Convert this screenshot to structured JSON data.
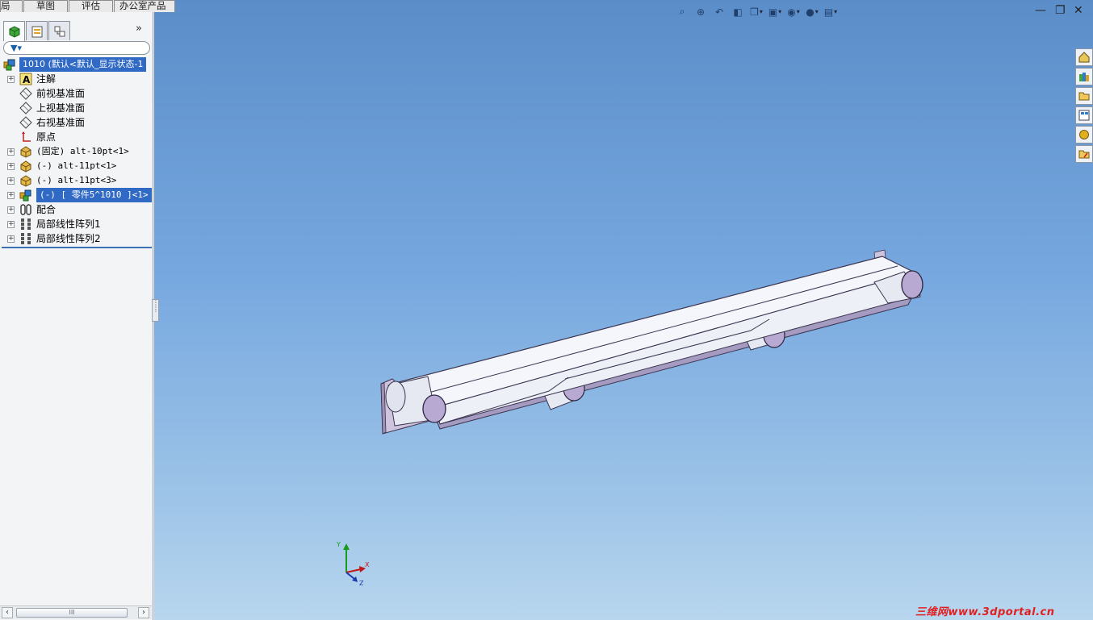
{
  "menu_tabs": [
    "局",
    "草图",
    "评估",
    "办公室产品"
  ],
  "panel": {
    "tabs": [
      {
        "icon": "featuremanager-icon"
      },
      {
        "icon": "propertymanager-icon"
      },
      {
        "icon": "configurationmanager-icon"
      }
    ],
    "expand_label": "»",
    "filter_icon": "filter-icon",
    "tree": [
      {
        "label": "1010  (默认<默认_显示状态-1",
        "icon": "assembly-icon",
        "selected": true
      },
      {
        "label": "注解",
        "icon": "annotation-icon"
      },
      {
        "label": "前视基准面",
        "icon": "plane-icon"
      },
      {
        "label": "上视基准面",
        "icon": "plane-icon"
      },
      {
        "label": "右视基准面",
        "icon": "plane-icon"
      },
      {
        "label": "原点",
        "icon": "origin-icon"
      },
      {
        "label": "(固定) alt-10pt<1>",
        "icon": "part-icon"
      },
      {
        "label": "(-) alt-11pt<1>",
        "icon": "part-icon"
      },
      {
        "label": "(-) alt-11pt<3>",
        "icon": "part-icon"
      },
      {
        "label": "(-) [ 零件5^1010 ]<1> ->",
        "icon": "virtual-part-icon",
        "selected": true
      },
      {
        "label": "配合",
        "icon": "mates-icon"
      },
      {
        "label": "局部线性阵列1",
        "icon": "pattern-icon"
      },
      {
        "label": "局部线性阵列2",
        "icon": "pattern-icon"
      }
    ],
    "scroll_thumb_label": "III"
  },
  "view_toolbar": [
    "zoom-to-fit-icon",
    "zoom-to-area-icon",
    "previous-view-icon",
    "section-view-icon",
    "view-orientation-icon",
    "display-style-icon",
    "hide-show-items-icon",
    "edit-appearance-icon",
    "apply-scene-icon",
    "view-settings-icon"
  ],
  "window_controls": {
    "minimize": "—",
    "restore": "❐",
    "close": "✕"
  },
  "task_pane": [
    "home-icon",
    "design-library-icon",
    "file-explorer-icon",
    "view-palette-icon",
    "appearances-icon",
    "custom-properties-icon"
  ],
  "axes": {
    "x": "X",
    "y": "Y",
    "z": "Z"
  },
  "watermark": "三维网www.3dportal.cn",
  "colors": {
    "viewport_top": "#5b8dc9",
    "viewport_bottom": "#b8d6ee",
    "selection": "#316ac5",
    "belt": "#f4f6fb",
    "roller": "#b8a9d2"
  }
}
